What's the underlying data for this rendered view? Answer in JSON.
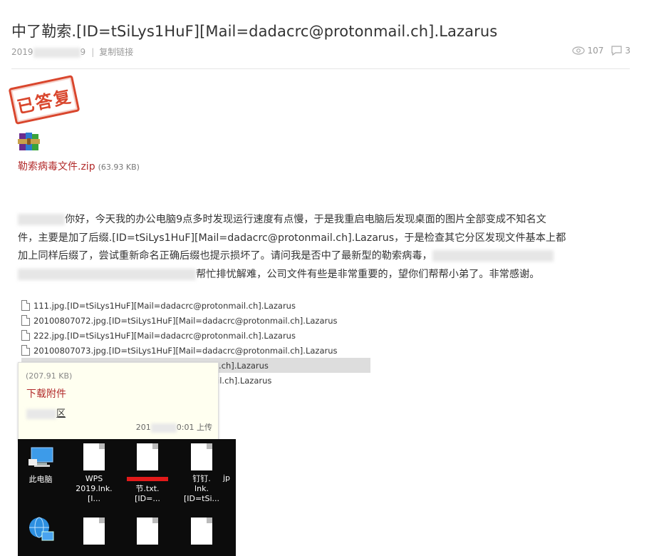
{
  "post": {
    "title": "中了勒索.[ID=tSiLys1HuF][Mail=dadacrc@protonmail.ch].Lazarus",
    "date_prefix": "2019",
    "date_suffix": "9",
    "copy_link": "复制链接",
    "views": "107",
    "replies": "3",
    "stamp_text": "已答复"
  },
  "attachment": {
    "name": "勒索病毒文件.zip",
    "size": "(63.93 KB)"
  },
  "body": {
    "line1": "你好，今天我的办公电脑9点多时发现运行速度有点慢，于是我重启电脑后发现桌面的图片全部变成不知名文",
    "line2": "件，主要是加了后缀.[ID=tSiLys1HuF][Mail=dadacrc@protonmail.ch].Lazarus，于是检查其它分区发现文件基本上都",
    "line3": "加上同样后缀了，尝试重新命名正确后缀也提示损坏了。请问我是否中了最新型的勒索病毒，",
    "line4": "帮忙排忧解难，公司文件有些是非常重要的，望你们帮帮小弟了。非常感谢。"
  },
  "files": [
    "111.jpg.[ID=tSiLys1HuF][Mail=dadacrc@protonmail.ch].Lazarus",
    "20100807072.jpg.[ID=tSiLys1HuF][Mail=dadacrc@protonmail.ch].Lazarus",
    "222.jpg.[ID=tSiLys1HuF][Mail=dadacrc@protonmail.ch].Lazarus",
    "20100807073.jpg.[ID=tSiLys1HuF][Mail=dadacrc@protonmail.ch].Lazarus",
    "onmail.ch].Lazarus",
    "ail.ch].Lazarus"
  ],
  "tooltip": {
    "size": "(207.91 KB)",
    "download": "下载附件",
    "area_suffix": "区",
    "upload_prefix": "201",
    "upload_suffix": "0:01 上传"
  },
  "desktop": {
    "icons": [
      {
        "label1": "此电脑",
        "label2": ""
      },
      {
        "label1": "WPS",
        "label2": "2019.lnk.[I..."
      },
      {
        "label1": "",
        "label2": "节.txt.[ID=..."
      },
      {
        "label1": "钉钉.",
        "label2": "lnk.[ID=tSi..."
      },
      {
        "label1": "",
        "label2": "jp"
      }
    ]
  }
}
